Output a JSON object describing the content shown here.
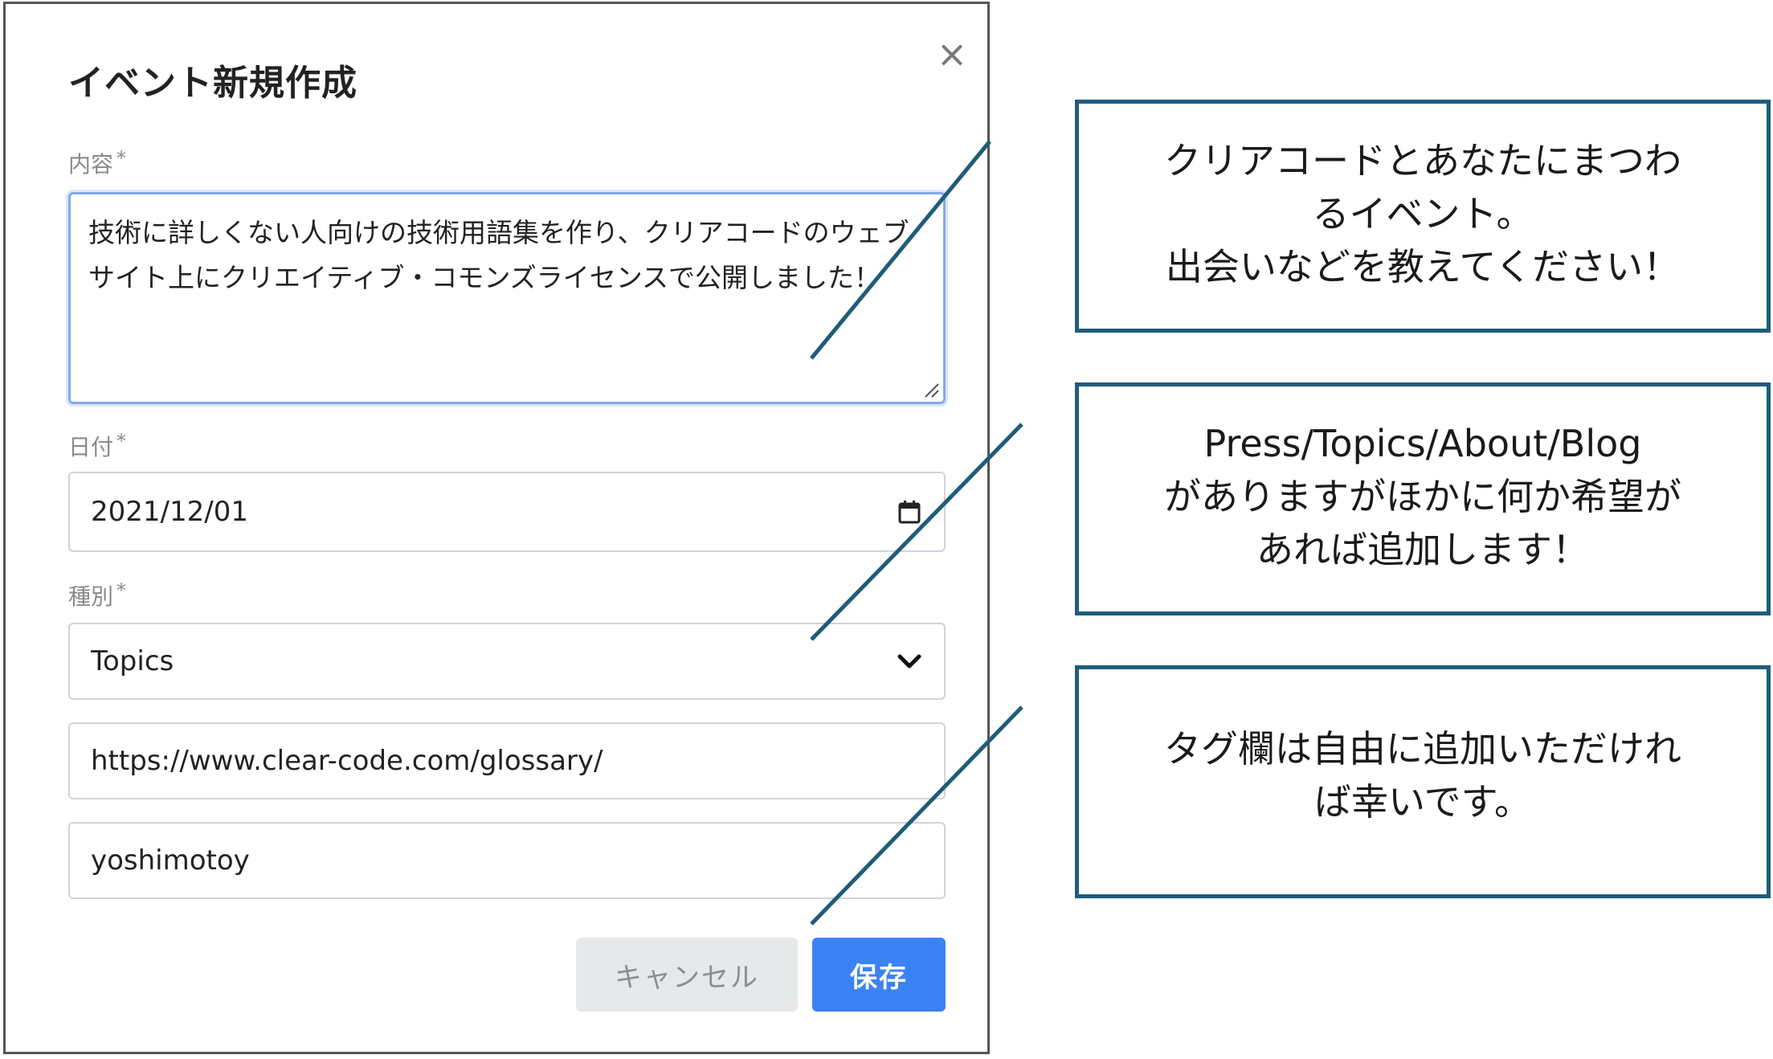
{
  "modal": {
    "title": "イベント新規作成",
    "close_symbol": "×",
    "fields": {
      "content": {
        "label": "内容",
        "required_mark": "*",
        "value": "技術に詳しくない人向けの技術用語集を作り、クリアコードのウェブサイト上にクリエイティブ・コモンズライセンスで公開しました！"
      },
      "date": {
        "label": "日付",
        "required_mark": "*",
        "value": "2021/12/01",
        "icon": "calendar-icon"
      },
      "type": {
        "label": "種別",
        "required_mark": "*",
        "value": "Topics",
        "icon": "chevron-down-icon"
      },
      "url": {
        "value": "https://www.clear-code.com/glossary/"
      },
      "tag": {
        "value": "yoshimotoy"
      }
    },
    "buttons": {
      "cancel_label": "キャンセル",
      "save_label": "保存"
    }
  },
  "callouts": [
    {
      "lines": [
        "クリアコードとあなたにまつわ",
        "るイベント。",
        "出会いなどを教えてください！"
      ]
    },
    {
      "lines": [
        "Press/Topics/About/Blog",
        "がありますがほかに何か希望が",
        "あれば追加します！"
      ]
    },
    {
      "lines": [
        "タグ欄は自由に追加いただけれ",
        "ば幸いです。"
      ]
    }
  ],
  "colors": {
    "callout_border": "#1f5c7a",
    "connector_line": "#1f5c7a",
    "save_button": "#3b82f6",
    "cancel_button": "#e6e8ea",
    "focus_border": "#86a8f0"
  }
}
